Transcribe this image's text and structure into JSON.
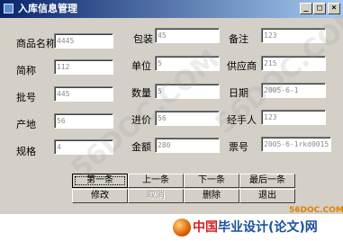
{
  "window": {
    "title": "入库信息管理"
  },
  "window_buttons": {
    "minimize": "_",
    "restore": "□",
    "close": "×"
  },
  "fields": {
    "product_name": {
      "label": "商品名称",
      "value": "4445"
    },
    "short_name": {
      "label": "简称",
      "value": "112"
    },
    "batch_no": {
      "label": "批号",
      "value": "445"
    },
    "origin": {
      "label": "产地",
      "value": "56"
    },
    "spec": {
      "label": "规格",
      "value": "4"
    },
    "packaging": {
      "label": "包装",
      "value": "45"
    },
    "unit": {
      "label": "单位",
      "value": "5"
    },
    "quantity": {
      "label": "数量",
      "value": "5"
    },
    "purchase_price": {
      "label": "进价",
      "value": "56"
    },
    "amount": {
      "label": "金额",
      "value": "280"
    },
    "remark": {
      "label": "备注",
      "value": "123"
    },
    "supplier": {
      "label": "供应商",
      "value": "215"
    },
    "date": {
      "label": "日期",
      "value": "2005-6-1"
    },
    "handler": {
      "label": "经手人",
      "value": "123"
    },
    "voucher_no": {
      "label": "票号",
      "value": "2005-6-1rkd0015"
    }
  },
  "buttons": {
    "first": "第一条",
    "prev": "上一条",
    "next": "下一条",
    "last": "最后一条",
    "edit": "修改",
    "cancel": "取消",
    "delete": "删除",
    "exit": "退出"
  },
  "footer": {
    "brand_part1": "中国",
    "brand_part2": "毕业设计(论文)网",
    "site": "56DOC.COM"
  },
  "watermark": {
    "text": "56DOC.COM"
  }
}
